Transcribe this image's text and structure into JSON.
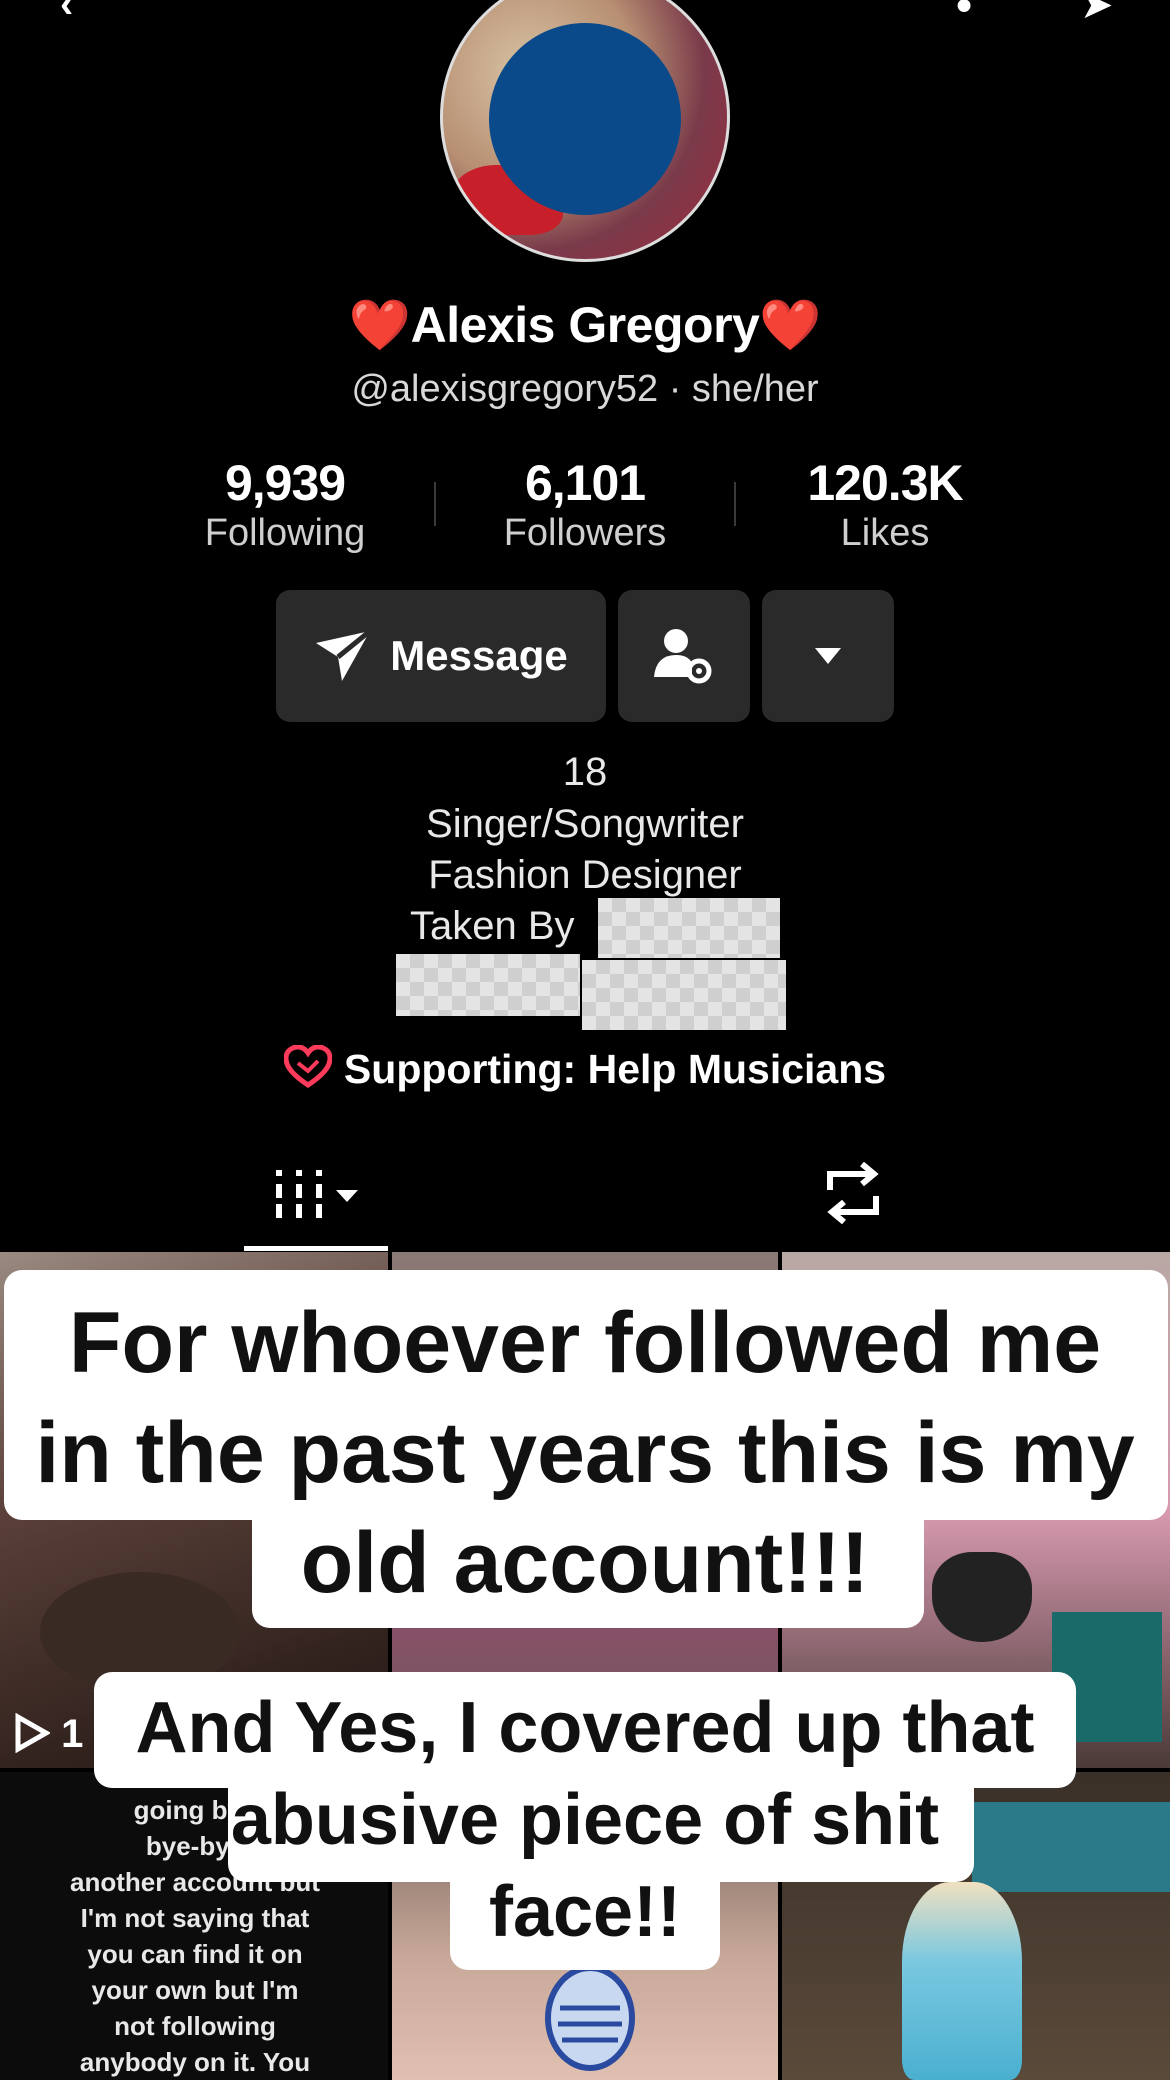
{
  "profile": {
    "name": "❤️Alexis Gregory❤️",
    "handle_line": "@alexisgregory52 · she/her"
  },
  "stats": [
    {
      "value": "9,939",
      "label": "Following"
    },
    {
      "value": "6,101",
      "label": "Followers"
    },
    {
      "value": "120.3K",
      "label": "Likes"
    }
  ],
  "actions": {
    "message_label": "Message"
  },
  "bio": {
    "line1": "18",
    "line2": "Singer/Songwriter",
    "line3": "Fashion Designer",
    "line4": "Taken By"
  },
  "supporting": "Supporting: Help Musicians",
  "grid": {
    "play_count": "1",
    "cell_text": "going bye\nbye-bye\nanother account but\nI'm not saying that\nyou can find it on\nyour own but I'm\nnot following\nanybody on it. You"
  },
  "overlay": {
    "caption1_line1": "For whoever followed me",
    "caption1_line2": "in the past years this is my",
    "caption1_line3": "old account!!!",
    "caption2_line1": "And Yes, I covered up that",
    "caption2_line2": "abusive piece of shit",
    "caption2_line3": "face!!"
  },
  "icons": [
    "back-icon",
    "notification-icon",
    "share-icon",
    "send-icon",
    "add-friend-settings-icon",
    "dropdown-icon",
    "fundraiser-heart-icon",
    "grid-icon",
    "repost-icon",
    "play-icon",
    "microphone-icon"
  ]
}
